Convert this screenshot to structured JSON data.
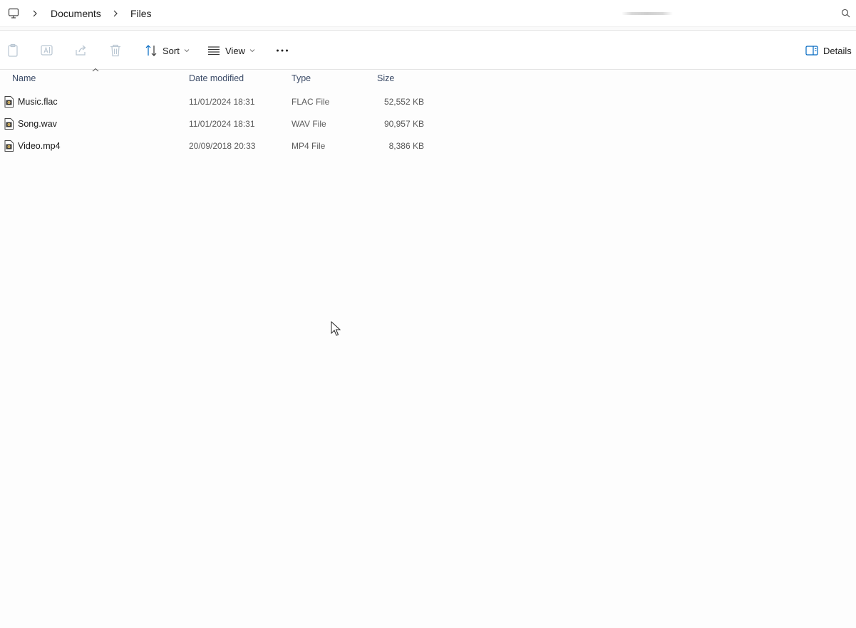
{
  "breadcrumb": {
    "items": [
      "Documents",
      "Files"
    ]
  },
  "toolbar": {
    "sort_label": "Sort",
    "view_label": "View",
    "details_label": "Details"
  },
  "columns": {
    "name": "Name",
    "date": "Date modified",
    "type": "Type",
    "size": "Size"
  },
  "files": [
    {
      "name": "Music.flac",
      "date": "11/01/2024 18:31",
      "type": "FLAC File",
      "size": "52,552 KB"
    },
    {
      "name": "Song.wav",
      "date": "11/01/2024 18:31",
      "type": "WAV File",
      "size": "90,957 KB"
    },
    {
      "name": "Video.mp4",
      "date": "20/09/2018 20:33",
      "type": "MP4 File",
      "size": "8,386 KB"
    }
  ],
  "colors": {
    "accent": "#0067c0",
    "header_text": "#3a4a66",
    "disabled_icon": "#b9c6d2"
  }
}
